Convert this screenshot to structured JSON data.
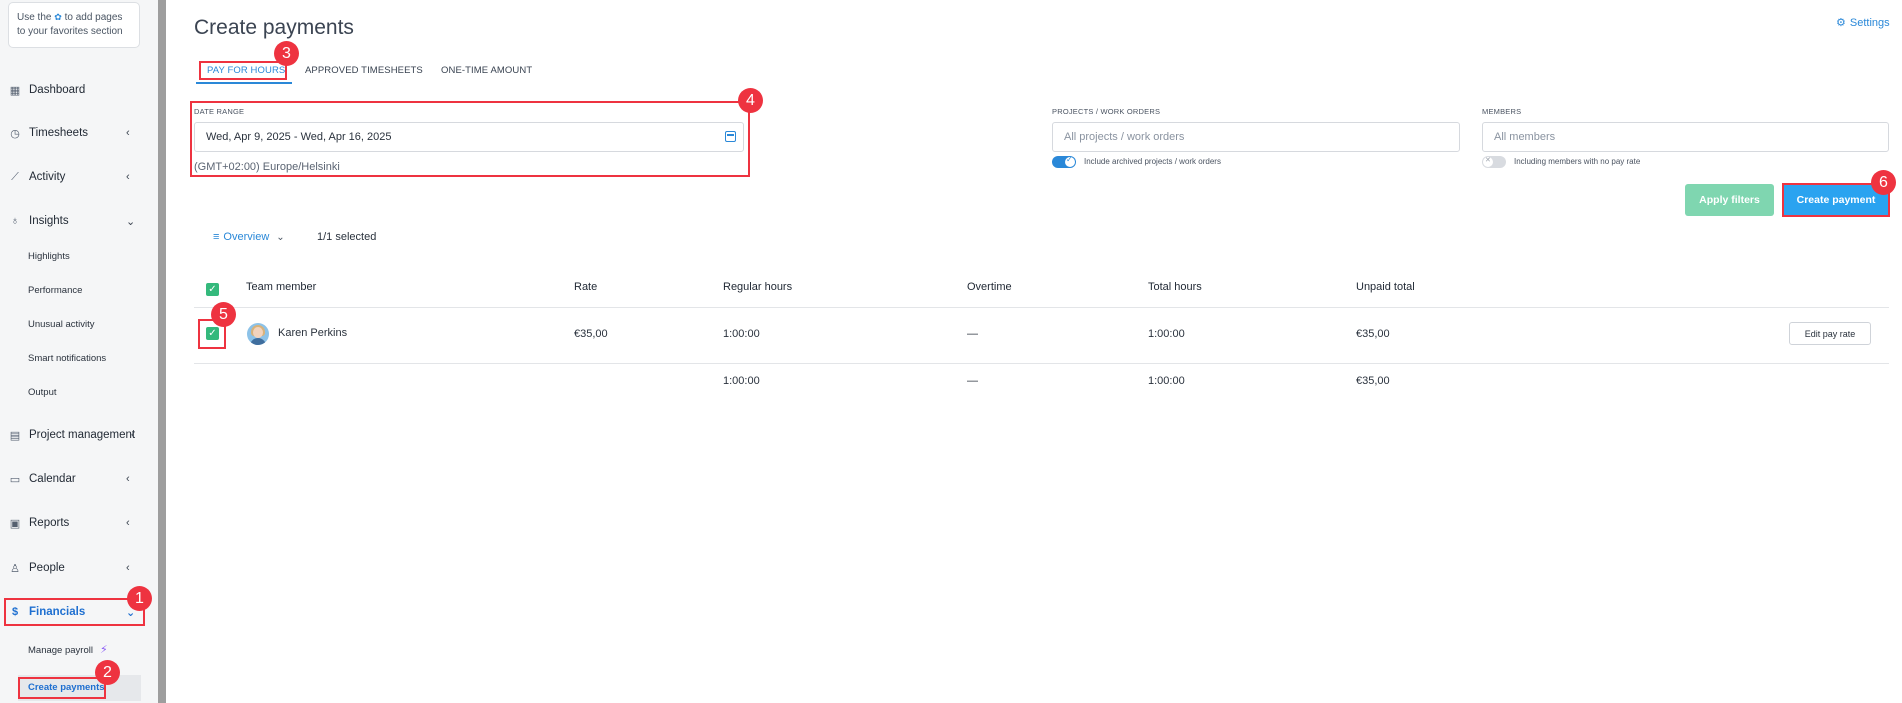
{
  "sidebar": {
    "favorites_tip_prefix": "Use the",
    "favorites_tip_suffix": "to add pages to your favorites section",
    "items": [
      {
        "label": "Dashboard",
        "icon": "dashboard-icon"
      },
      {
        "label": "Timesheets",
        "icon": "clock-icon"
      },
      {
        "label": "Activity",
        "icon": "activity-icon"
      },
      {
        "label": "Insights",
        "icon": "lightbulb-icon"
      },
      {
        "label": "Project management",
        "icon": "clipboard-icon"
      },
      {
        "label": "Calendar",
        "icon": "calendar-icon"
      },
      {
        "label": "Reports",
        "icon": "report-icon"
      },
      {
        "label": "People",
        "icon": "person-icon"
      },
      {
        "label": "Financials",
        "icon": "dollar-icon"
      }
    ],
    "insights_sub": [
      "Highlights",
      "Performance",
      "Unusual activity",
      "Smart notifications",
      "Output"
    ],
    "financials_sub": [
      "Manage payroll",
      "Create payments"
    ]
  },
  "main": {
    "title": "Create payments",
    "settings_label": "Settings",
    "tabs": [
      "PAY FOR HOURS",
      "APPROVED TIMESHEETS",
      "ONE-TIME AMOUNT"
    ],
    "date_range": {
      "label": "DATE RANGE",
      "value": "Wed, Apr 9, 2025 - Wed, Apr 16, 2025",
      "timezone": "(GMT+02:00) Europe/Helsinki"
    },
    "projects": {
      "label": "PROJECTS / WORK ORDERS",
      "placeholder": "All projects / work orders",
      "toggle_label": "Include archived projects / work orders",
      "toggle_on": true
    },
    "members": {
      "label": "MEMBERS",
      "placeholder": "All members",
      "toggle_label": "Including members with no pay rate",
      "toggle_on": false
    },
    "apply_filters_label": "Apply filters",
    "create_payment_label": "Create payment",
    "view_label": "Overview",
    "selected_text": "1/1 selected",
    "table": {
      "headers": [
        "Team member",
        "Rate",
        "Regular hours",
        "Overtime",
        "Total hours",
        "Unpaid total"
      ],
      "rows": [
        {
          "member": "Karen Perkins",
          "rate": "€35,00",
          "regular": "1:00:00",
          "overtime": "—",
          "total": "1:00:00",
          "unpaid": "€35,00",
          "action": "Edit pay rate"
        }
      ],
      "totals": {
        "regular": "1:00:00",
        "overtime": "—",
        "total": "1:00:00",
        "unpaid": "€35,00"
      }
    }
  },
  "annotations": [
    "1",
    "2",
    "3",
    "4",
    "5",
    "6"
  ],
  "colors": {
    "accent": "#2a88d8",
    "success": "#34b97c",
    "highlight": "#ee3340",
    "primary_button": "#2aa3f0",
    "apply_button": "#7fd6b0"
  }
}
